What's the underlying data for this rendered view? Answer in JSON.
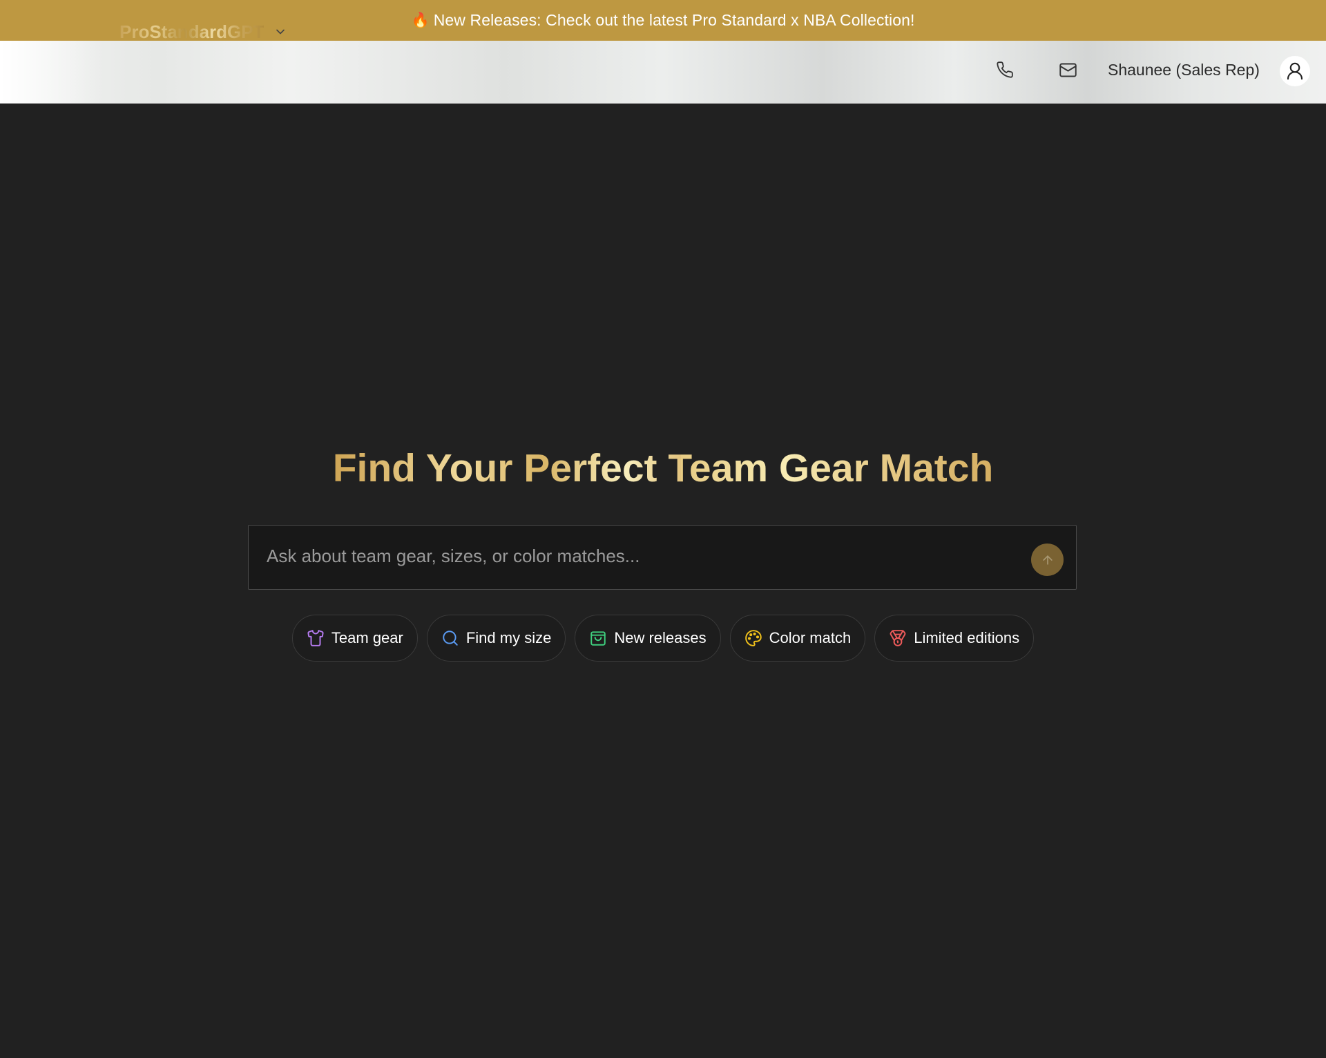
{
  "banner": {
    "icon": "fire-icon",
    "text": "New Releases: Check out the latest Pro Standard x NBA Collection!",
    "background_color": "#be9841"
  },
  "header": {
    "brand": "ProStandardGPT",
    "brand_icon": "chevron-down-icon",
    "phone_icon": "phone-icon",
    "mail_icon": "mail-icon",
    "user_name": "Shaunee (Sales Rep)",
    "avatar_icon": "user-icon"
  },
  "hero": {
    "title": "Find Your Perfect Team Gear Match"
  },
  "search": {
    "placeholder": "Ask about team gear, sizes, or color matches...",
    "value": "",
    "send_icon": "arrow-up-icon"
  },
  "chips": [
    {
      "label": "Team gear",
      "icon": "shirt-icon",
      "icon_color": "#b57bf0"
    },
    {
      "label": "Find my size",
      "icon": "search-icon",
      "icon_color": "#5b9cf5"
    },
    {
      "label": "New releases",
      "icon": "shopping-bag-icon",
      "icon_color": "#3fcf7e"
    },
    {
      "label": "Color match",
      "icon": "palette-icon",
      "icon_color": "#f2c21b"
    },
    {
      "label": "Limited editions",
      "icon": "medal-icon",
      "icon_color": "#ef5b5b"
    }
  ],
  "colors": {
    "page_background": "#212121",
    "accent_gold": "#be9841",
    "send_button": "#7a6232"
  }
}
